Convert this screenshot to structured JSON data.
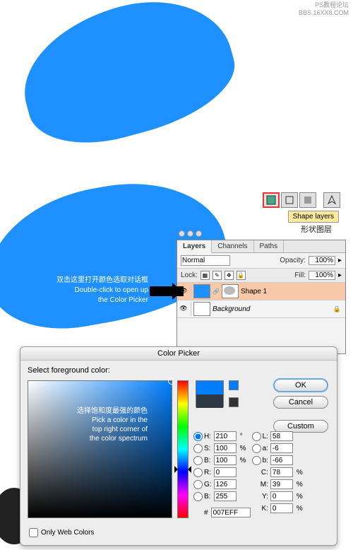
{
  "watermark": {
    "l1": "PS教程论坛",
    "l2": "BBS.16XX8.COM"
  },
  "toolopts": {
    "tooltip": "Shape layers",
    "tooltip_cn": "形状图层"
  },
  "layers": {
    "tabs": [
      "Layers",
      "Channels",
      "Paths"
    ],
    "blend": "Normal",
    "opacity_label": "Opacity:",
    "opacity": "100%",
    "lock_label": "Lock:",
    "fill_label": "Fill:",
    "fill": "100%",
    "items": [
      {
        "name": "Shape 1"
      },
      {
        "name": "Background"
      }
    ]
  },
  "annot1": {
    "cn": "双击这里打开颜色选取对话框",
    "en1": "Double-click to open up",
    "en2": "the Color Picker"
  },
  "cp": {
    "title": "Color Picker",
    "subtitle": "Select foreground color:",
    "annot_cn": "选择饱和度最强的颜色",
    "annot_en1": "Pick a color in the",
    "annot_en2": "top right corner of",
    "annot_en3": "the color spectrum",
    "btn_ok": "OK",
    "btn_cancel": "Cancel",
    "btn_custom": "Custom",
    "H": "210",
    "Hu": "°",
    "S": "100",
    "Su": "%",
    "Bv": "100",
    "Bu": "%",
    "R": "0",
    "G": "126",
    "Bc": "255",
    "L": "58",
    "a": "-6",
    "b": "-66",
    "C": "78",
    "Cu": "%",
    "M": "39",
    "Mu": "%",
    "Y": "0",
    "Yu": "%",
    "K": "0",
    "Ku": "%",
    "hex_lbl": "#",
    "hex": "007EFF",
    "owc": "Only Web Colors"
  }
}
